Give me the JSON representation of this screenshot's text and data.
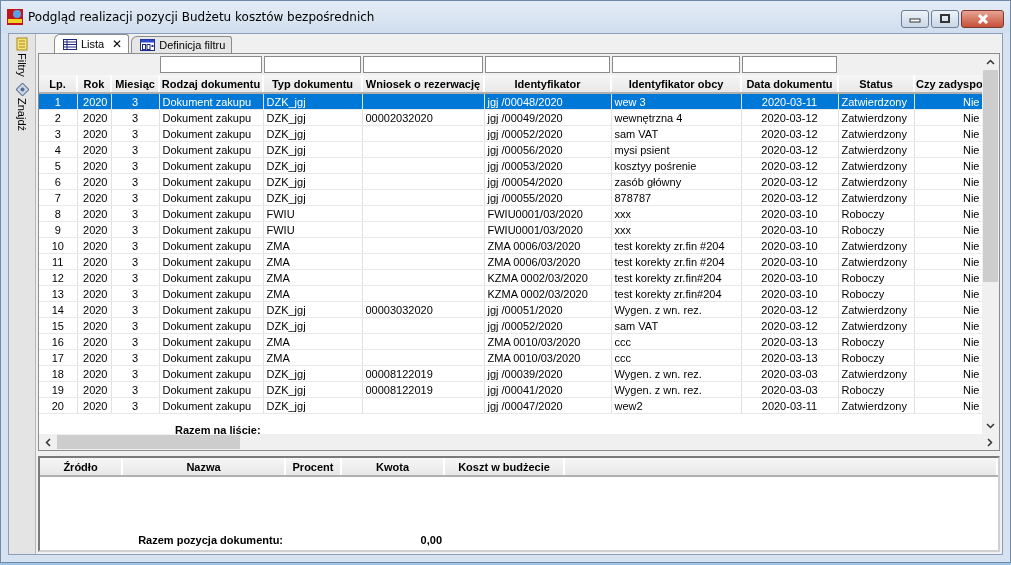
{
  "window": {
    "title": "Podgląd realizacji pozycji Budżetu kosztów bezpośrednich"
  },
  "side_toolbar": [
    {
      "label": "Filtry",
      "kind": "filter"
    },
    {
      "label": "Znajdź",
      "kind": "find"
    }
  ],
  "tabs": [
    {
      "label": "Lista",
      "selected": true,
      "close": "✕",
      "kind": "list"
    },
    {
      "label": "Definicja filtru",
      "selected": false,
      "kind": "filter"
    }
  ],
  "table": {
    "columns": [
      {
        "label": "Lp.",
        "filter": false
      },
      {
        "label": "Rok",
        "filter": false
      },
      {
        "label": "Miesiąc",
        "filter": false
      },
      {
        "label": "Rodzaj dokumentu",
        "filter": true
      },
      {
        "label": "Typ dokumentu",
        "filter": true
      },
      {
        "label": "Wniosek o rezerwację",
        "filter": true
      },
      {
        "label": "Identyfikator",
        "filter": true
      },
      {
        "label": "Identyfikator obcy",
        "filter": true
      },
      {
        "label": "Data dokumentu",
        "filter": true
      },
      {
        "label": "Status",
        "filter": false
      },
      {
        "label": "Czy zadyspo",
        "filter": false
      }
    ],
    "rows": [
      {
        "selected": true,
        "cells": [
          "1",
          "2020",
          "3",
          "Dokument zakupu",
          "DZK_jgj",
          null,
          "jgj /00048/2020",
          "wew 3",
          "2020-03-11",
          "Zatwierdzony",
          "Nie"
        ]
      },
      {
        "selected": false,
        "cells": [
          "2",
          "2020",
          "3",
          "Dokument zakupu",
          "DZK_jgj",
          "00002032020",
          "jgj /00049/2020",
          "wewnętrzna 4",
          "2020-03-12",
          "Zatwierdzony",
          "Nie"
        ]
      },
      {
        "selected": false,
        "cells": [
          "3",
          "2020",
          "3",
          "Dokument zakupu",
          "DZK_jgj",
          null,
          "jgj /00052/2020",
          "sam VAT",
          "2020-03-12",
          "Zatwierdzony",
          "Nie"
        ]
      },
      {
        "selected": false,
        "cells": [
          "4",
          "2020",
          "3",
          "Dokument zakupu",
          "DZK_jgj",
          null,
          "jgj /00056/2020",
          "mysi psient",
          "2020-03-12",
          "Zatwierdzony",
          "Nie"
        ]
      },
      {
        "selected": false,
        "cells": [
          "5",
          "2020",
          "3",
          "Dokument zakupu",
          "DZK_jgj",
          null,
          "jgj /00053/2020",
          "kosztyy pośrenie",
          "2020-03-12",
          "Zatwierdzony",
          "Nie"
        ]
      },
      {
        "selected": false,
        "cells": [
          "6",
          "2020",
          "3",
          "Dokument zakupu",
          "DZK_jgj",
          null,
          "jgj /00054/2020",
          "zasób główny",
          "2020-03-12",
          "Zatwierdzony",
          "Nie"
        ]
      },
      {
        "selected": false,
        "cells": [
          "7",
          "2020",
          "3",
          "Dokument zakupu",
          "DZK_jgj",
          null,
          "jgj /00055/2020",
          "878787",
          "2020-03-12",
          "Zatwierdzony",
          "Nie"
        ]
      },
      {
        "selected": false,
        "cells": [
          "8",
          "2020",
          "3",
          "Dokument zakupu",
          "FWIU",
          null,
          "FWIU0001/03/2020",
          "xxx",
          "2020-03-10",
          "Roboczy",
          "Nie"
        ]
      },
      {
        "selected": false,
        "cells": [
          "9",
          "2020",
          "3",
          "Dokument zakupu",
          "FWIU",
          null,
          "FWIU0001/03/2020",
          "xxx",
          "2020-03-10",
          "Roboczy",
          "Nie"
        ]
      },
      {
        "selected": false,
        "cells": [
          "10",
          "2020",
          "3",
          "Dokument zakupu",
          "ZMA",
          null,
          "ZMA 0006/03/2020",
          "test korekty zr.fin #204",
          "2020-03-10",
          "Zatwierdzony",
          "Nie"
        ]
      },
      {
        "selected": false,
        "cells": [
          "11",
          "2020",
          "3",
          "Dokument zakupu",
          "ZMA",
          null,
          "ZMA 0006/03/2020",
          "test korekty zr.fin #204",
          "2020-03-10",
          "Zatwierdzony",
          "Nie"
        ]
      },
      {
        "selected": false,
        "cells": [
          "12",
          "2020",
          "3",
          "Dokument zakupu",
          "ZMA",
          null,
          "KZMA 0002/03/2020",
          "test korekty zr.fin#204",
          "2020-03-10",
          "Roboczy",
          "Nie"
        ]
      },
      {
        "selected": false,
        "cells": [
          "13",
          "2020",
          "3",
          "Dokument zakupu",
          "ZMA",
          null,
          "KZMA 0002/03/2020",
          "test korekty zr.fin#204",
          "2020-03-10",
          "Roboczy",
          "Nie"
        ]
      },
      {
        "selected": false,
        "cells": [
          "14",
          "2020",
          "3",
          "Dokument zakupu",
          "DZK_jgj",
          "00003032020",
          "jgj /00051/2020",
          "Wygen. z wn. rez.",
          "2020-03-12",
          "Zatwierdzony",
          "Nie"
        ]
      },
      {
        "selected": false,
        "cells": [
          "15",
          "2020",
          "3",
          "Dokument zakupu",
          "DZK_jgj",
          null,
          "jgj /00052/2020",
          "sam VAT",
          "2020-03-12",
          "Zatwierdzony",
          "Nie"
        ]
      },
      {
        "selected": false,
        "cells": [
          "16",
          "2020",
          "3",
          "Dokument zakupu",
          "ZMA",
          null,
          "ZMA 0010/03/2020",
          "ccc",
          "2020-03-13",
          "Roboczy",
          "Nie"
        ]
      },
      {
        "selected": false,
        "cells": [
          "17",
          "2020",
          "3",
          "Dokument zakupu",
          "ZMA",
          null,
          "ZMA 0010/03/2020",
          "ccc",
          "2020-03-13",
          "Roboczy",
          "Nie"
        ]
      },
      {
        "selected": false,
        "cells": [
          "18",
          "2020",
          "3",
          "Dokument zakupu",
          "DZK_jgj",
          "00008122019",
          "jgj /00039/2020",
          "Wygen. z wn. rez.",
          "2020-03-03",
          "Zatwierdzony",
          "Nie"
        ]
      },
      {
        "selected": false,
        "cells": [
          "19",
          "2020",
          "3",
          "Dokument zakupu",
          "DZK_jgj",
          "00008122019",
          "jgj /00041/2020",
          "Wygen. z wn. rez.",
          "2020-03-03",
          "Roboczy",
          "Nie"
        ]
      },
      {
        "selected": false,
        "cells": [
          "20",
          "2020",
          "3",
          "Dokument zakupu",
          "DZK_jgj",
          null,
          "jgj /00047/2020",
          "wew2",
          "2020-03-11",
          "Zatwierdzony",
          "Nie"
        ]
      }
    ],
    "footer": {
      "label": "Razem na liście:"
    }
  },
  "details": {
    "columns": [
      "Źródło",
      "Nazwa",
      "Procent",
      "Kwota",
      "Koszt w budżecie"
    ],
    "footer": {
      "label": "Razem pozycja dokumentu:",
      "value": "0,00"
    }
  }
}
